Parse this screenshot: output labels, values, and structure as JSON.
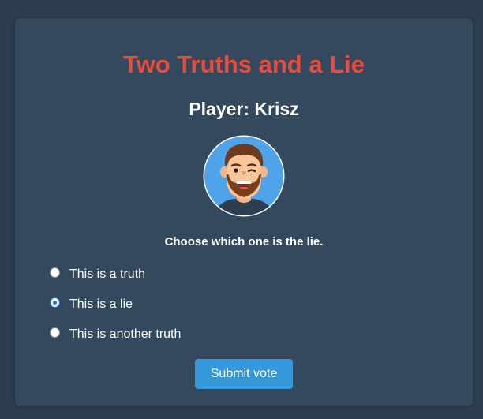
{
  "title": "Two Truths and a Lie",
  "player_label": "Player: Krisz",
  "avatar_icon": "smiling-bearded-man-avatar",
  "prompt": "Choose which one is the lie.",
  "options": [
    {
      "label": "This is a truth",
      "checked": false
    },
    {
      "label": "This is a lie",
      "checked": true
    },
    {
      "label": "This is another truth",
      "checked": false
    }
  ],
  "submit_label": "Submit vote",
  "colors": {
    "background": "#2d3e50",
    "card": "#34495e",
    "title": "#e74c3c",
    "button": "#3498db",
    "radio_selected": "#0075ff"
  }
}
